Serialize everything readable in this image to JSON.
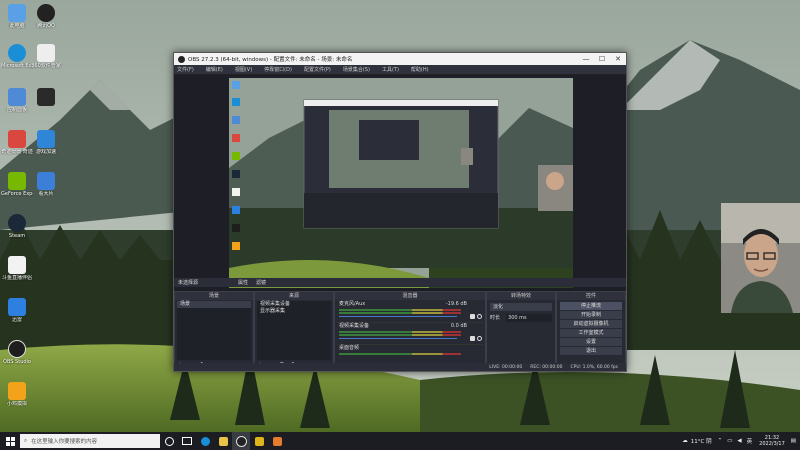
{
  "desktop": {
    "icons": [
      {
        "label": "此电脑",
        "color": "#5aa0e6"
      },
      {
        "label": "腾讯QQ",
        "color": "#222222"
      },
      {
        "label": "Microsoft Edge",
        "color": "#1a8fd6"
      },
      {
        "label": "360软件管家",
        "color": "#ffffff"
      },
      {
        "label": "控制面板",
        "color": "#4f8ad6"
      },
      {
        "label": "",
        "color": "#2a2a2a"
      },
      {
        "label": "奇迹暖暖 奇迹",
        "color": "#d9473f"
      },
      {
        "label": "游戏加速",
        "color": "#2f86d9"
      },
      {
        "label": "GeForce Experience",
        "color": "#76b900"
      },
      {
        "label": "看大片",
        "color": "#3b7fd9"
      },
      {
        "label": "Steam",
        "color": "#1b2838"
      },
      {
        "label": "斗鱼直播伴侣",
        "color": "#f2f2f2"
      },
      {
        "label": "迅雷",
        "color": "#2d7fe0"
      },
      {
        "label": "OBS Studio",
        "color": "#1e1e1e"
      },
      {
        "label": "小鸡模拟",
        "color": "#f2a31a"
      }
    ]
  },
  "obs": {
    "title": "OBS 27.2.3 (64-bit, windows) - 配置文件: 未命名 - 场景: 未命名",
    "menu": [
      "文件(F)",
      "编辑(E)",
      "视图(V)",
      "停靠窗口(D)",
      "配置文件(P)",
      "场景集合(S)",
      "工具(T)",
      "帮助(H)"
    ],
    "window_controls": [
      "—",
      "☐",
      "✕"
    ],
    "scene_bar": {
      "label": "未选择源",
      "properties": "属性",
      "filters": "滤镜"
    },
    "docks": {
      "scenes": {
        "header": "场景",
        "items": [
          "场景"
        ]
      },
      "sources": {
        "header": "来源",
        "items": [
          "视频采集设备",
          "显示器采集"
        ]
      },
      "mixer": {
        "header": "混音器",
        "tracks": [
          {
            "name": "麦克风/Aux",
            "db": "-19.6 dB"
          },
          {
            "name": "视频采集设备",
            "db": "0.0 dB"
          },
          {
            "name": "桌面音频",
            "db": ""
          }
        ]
      },
      "transitions": {
        "header": "转场特效",
        "type": "淡化",
        "duration_label": "时长",
        "duration": "300 ms"
      },
      "controls": {
        "header": "控件",
        "buttons": [
          "停止推流",
          "开始录制",
          "启动虚拟摄像机",
          "工作室模式",
          "设置",
          "退出"
        ]
      }
    },
    "status": {
      "live": "LIVE: 00:00:00",
      "rec": "REC: 00:00:00",
      "cpu": "CPU: 1.0%, 60.00 fps"
    }
  },
  "taskbar": {
    "search_placeholder": "在这里输入你要搜索的内容",
    "weather": "11°C 阴",
    "time": "21:32",
    "date": "2022/3/17",
    "lang": "英"
  }
}
